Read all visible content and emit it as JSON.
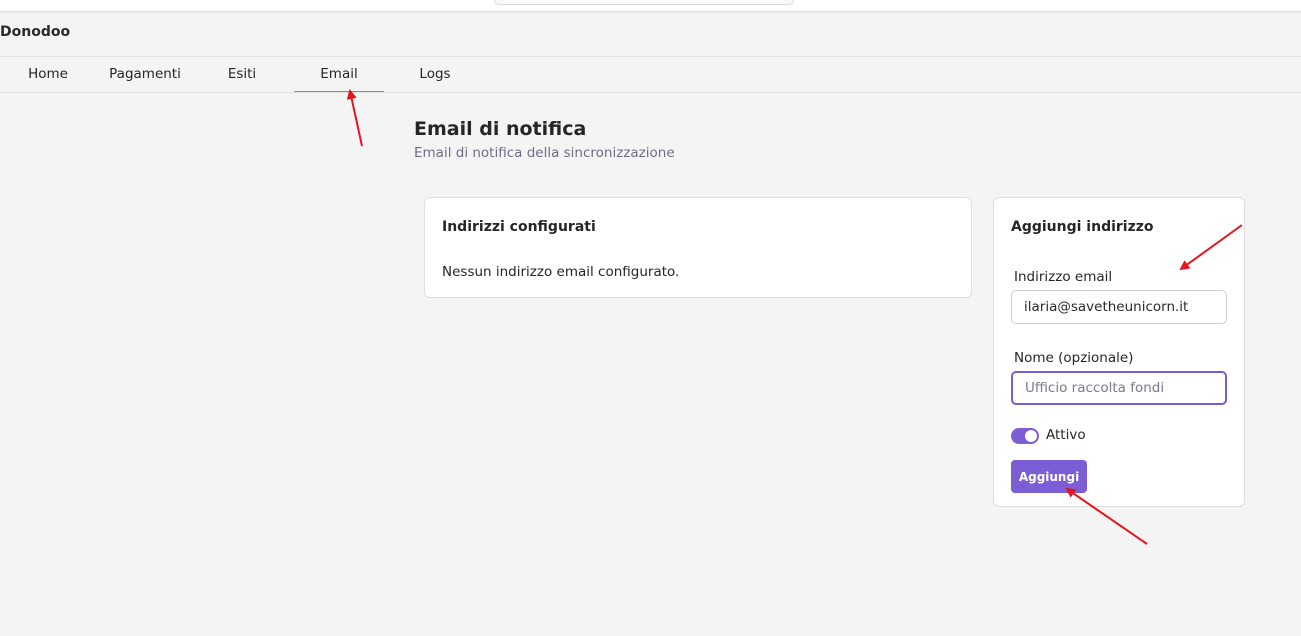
{
  "app": {
    "brand": "Donodoo"
  },
  "nav": {
    "tabs": [
      {
        "label": "Home",
        "active": false
      },
      {
        "label": "Pagamenti",
        "active": false
      },
      {
        "label": "Esiti",
        "active": false
      },
      {
        "label": "Email",
        "active": true
      },
      {
        "label": "Logs",
        "active": false
      }
    ]
  },
  "page": {
    "title": "Email di notifica",
    "subtitle": "Email di notifica della sincronizzazione"
  },
  "addresses_card": {
    "title": "Indirizzi configurati",
    "empty_message": "Nessun indirizzo email configurato."
  },
  "add_card": {
    "title": "Aggiungi indirizzo",
    "email_label": "Indirizzo email",
    "email_value": "ilaria@savetheunicorn.it",
    "name_label": "Nome (opzionale)",
    "name_placeholder": "Ufficio raccolta fondi",
    "active_label": "Attivo",
    "active_on": true,
    "submit_label": "Aggiungi"
  },
  "colors": {
    "accent": "#7b5ed6",
    "annotation_arrow": "#e8131b",
    "background": "#f4f4f4"
  }
}
